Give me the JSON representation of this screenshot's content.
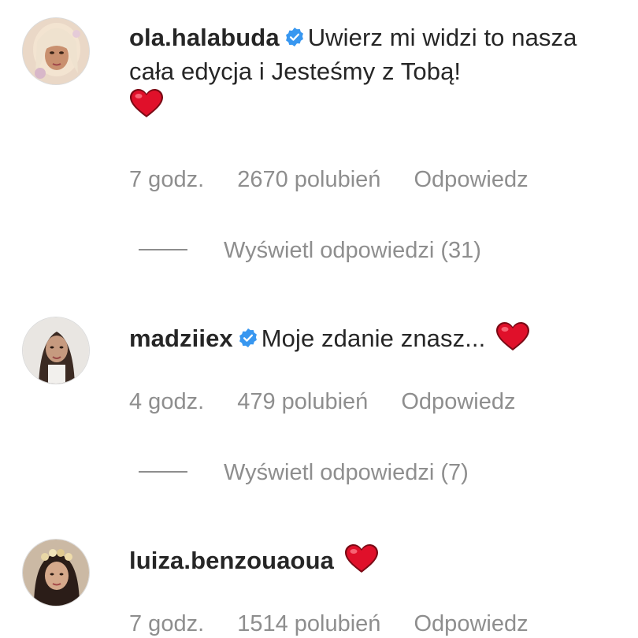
{
  "comments": [
    {
      "username": "ola.halabuda",
      "verified": true,
      "text": "Uwierz mi widzi to nasza cała edycja i Jesteśmy z Tobą!",
      "emoji": "red-heart",
      "time": "7 godz.",
      "likes": "2670 polubień",
      "reply": "Odpowiedz",
      "view_replies": "Wyświetl odpowiedzi (31)"
    },
    {
      "username": "madziiex",
      "verified": true,
      "text": "Moje zdanie znasz...",
      "emoji": "red-heart",
      "time": "4 godz.",
      "likes": "479 polubień",
      "reply": "Odpowiedz",
      "view_replies": "Wyświetl odpowiedzi (7)"
    },
    {
      "username": "luiza.benzouaoua",
      "verified": false,
      "text": "",
      "emoji": "red-heart",
      "time": "7 godz.",
      "likes": "1514 polubień",
      "reply": "Odpowiedz"
    }
  ],
  "colors": {
    "text": "#262626",
    "muted": "#8e8e8e",
    "verified": "#3897f0",
    "heart": "#e0102a"
  }
}
